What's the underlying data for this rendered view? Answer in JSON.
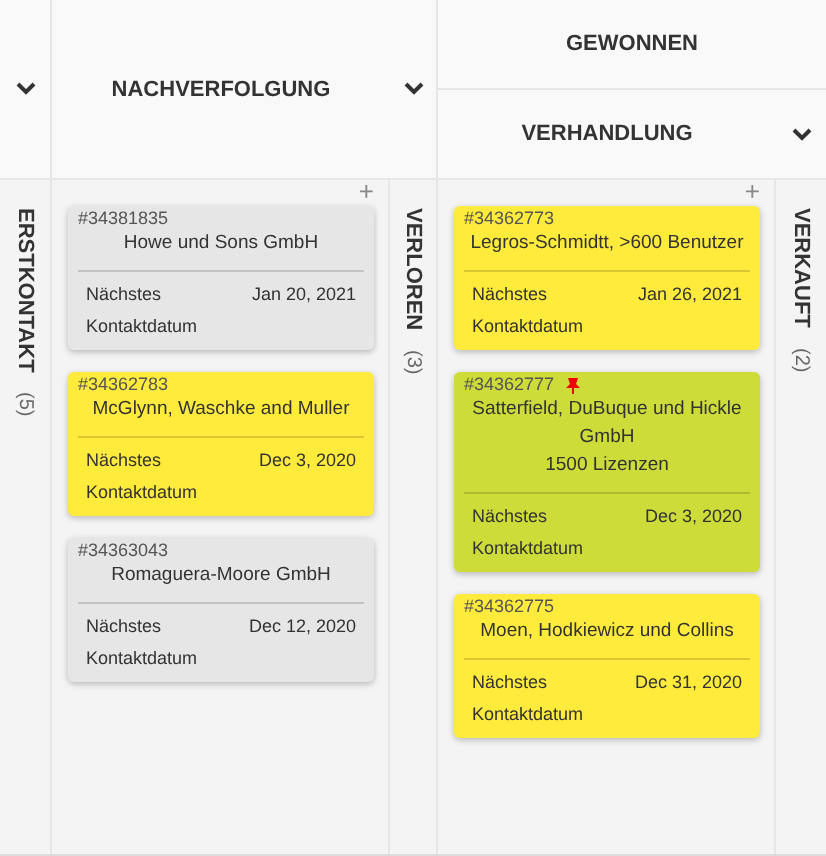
{
  "columns": [
    {
      "kind": "collapsed",
      "title": "ERSTKONTAKT",
      "count": "(5)"
    },
    {
      "kind": "open",
      "title": "NACHVERFOLGUNG",
      "add": "+",
      "cards": [
        {
          "number": "#34381835",
          "pinned": false,
          "color": "#e6e6e6",
          "lines": [
            "Howe und Sons GmbH"
          ],
          "next_label": "Nächstes",
          "date": "Jan 20, 2021",
          "contact_label": "Kontaktdatum"
        },
        {
          "number": "#34362783",
          "pinned": false,
          "color": "#ffeb3b",
          "lines": [
            "McGlynn, Waschke and Muller"
          ],
          "next_label": "Nächstes",
          "date": "Dec 3, 2020",
          "contact_label": "Kontaktdatum"
        },
        {
          "number": "#34363043",
          "pinned": false,
          "color": "#e6e6e6",
          "lines": [
            "Romaguera-Moore GmbH"
          ],
          "next_label": "Nächstes",
          "date": "Dec 12, 2020",
          "contact_label": "Kontaktdatum"
        }
      ]
    },
    {
      "kind": "collapsed",
      "title": "VERLOREN",
      "count": "(3)"
    },
    {
      "kind": "open",
      "title": "VERHANDLUNG",
      "group": "GEWONNEN",
      "add": "+",
      "cards": [
        {
          "number": "#34362773",
          "pinned": false,
          "color": "#ffeb3b",
          "lines": [
            "Legros-Schmidtt, >600 Benutzer"
          ],
          "next_label": "Nächstes",
          "date": "Jan 26, 2021",
          "contact_label": "Kontaktdatum"
        },
        {
          "number": "#34362777",
          "pinned": true,
          "color": "#cddc39",
          "lines": [
            "Satterfield, DuBuque und Hickle GmbH",
            "1500 Lizenzen"
          ],
          "next_label": "Nächstes",
          "date": "Dec 3, 2020",
          "contact_label": "Kontaktdatum"
        },
        {
          "number": "#34362775",
          "pinned": false,
          "color": "#ffeb3b",
          "lines": [
            "Moen, Hodkiewicz und Collins"
          ],
          "next_label": "Nächstes",
          "date": "Dec 31, 2020",
          "contact_label": "Kontaktdatum"
        }
      ]
    },
    {
      "kind": "collapsed",
      "title": "VERKAUFT",
      "count": "(2)"
    }
  ]
}
